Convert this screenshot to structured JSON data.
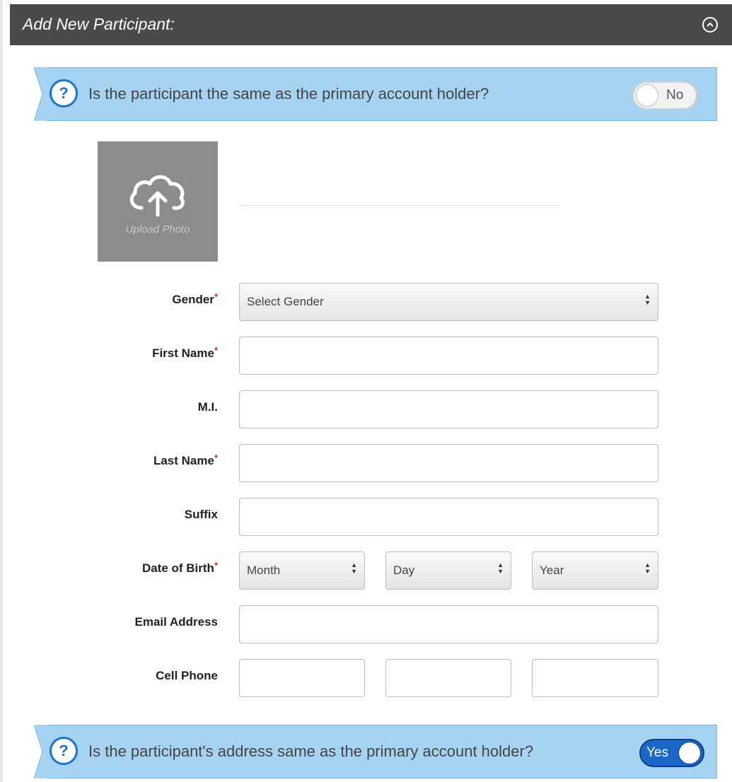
{
  "header": {
    "title": "Add New Participant:"
  },
  "banner_same_participant": {
    "question": "Is the participant the same as the primary account holder?",
    "help_glyph": "?",
    "toggle_label": "No",
    "toggle_state": "off"
  },
  "photo": {
    "upload_label": "Upload Photo"
  },
  "form": {
    "required_marker": "*",
    "gender": {
      "label": "Gender",
      "required": true,
      "selected": "Select Gender"
    },
    "first_name": {
      "label": "First Name",
      "required": true,
      "value": ""
    },
    "middle_initial": {
      "label": "M.I.",
      "required": false,
      "value": ""
    },
    "last_name": {
      "label": "Last Name",
      "required": true,
      "value": ""
    },
    "suffix": {
      "label": "Suffix",
      "required": false,
      "value": ""
    },
    "date_of_birth": {
      "label": "Date of Birth",
      "required": true,
      "month": "Month",
      "day": "Day",
      "year": "Year"
    },
    "email": {
      "label": "Email Address",
      "required": false,
      "value": ""
    },
    "cell_phone": {
      "label": "Cell Phone",
      "required": false,
      "parts": [
        "",
        "",
        ""
      ]
    }
  },
  "banner_same_address": {
    "question": "Is the participant's address same as the primary account holder?",
    "help_glyph": "?",
    "toggle_label": "Yes",
    "toggle_state": "on"
  },
  "colors": {
    "header_bg": "#4a4a4a",
    "banner_bg": "#a7d3f2",
    "accent_blue": "#1a73d1",
    "toggle_on": "#1a66c9",
    "required": "#c0392b",
    "upload_bg": "#8c8c8c"
  }
}
